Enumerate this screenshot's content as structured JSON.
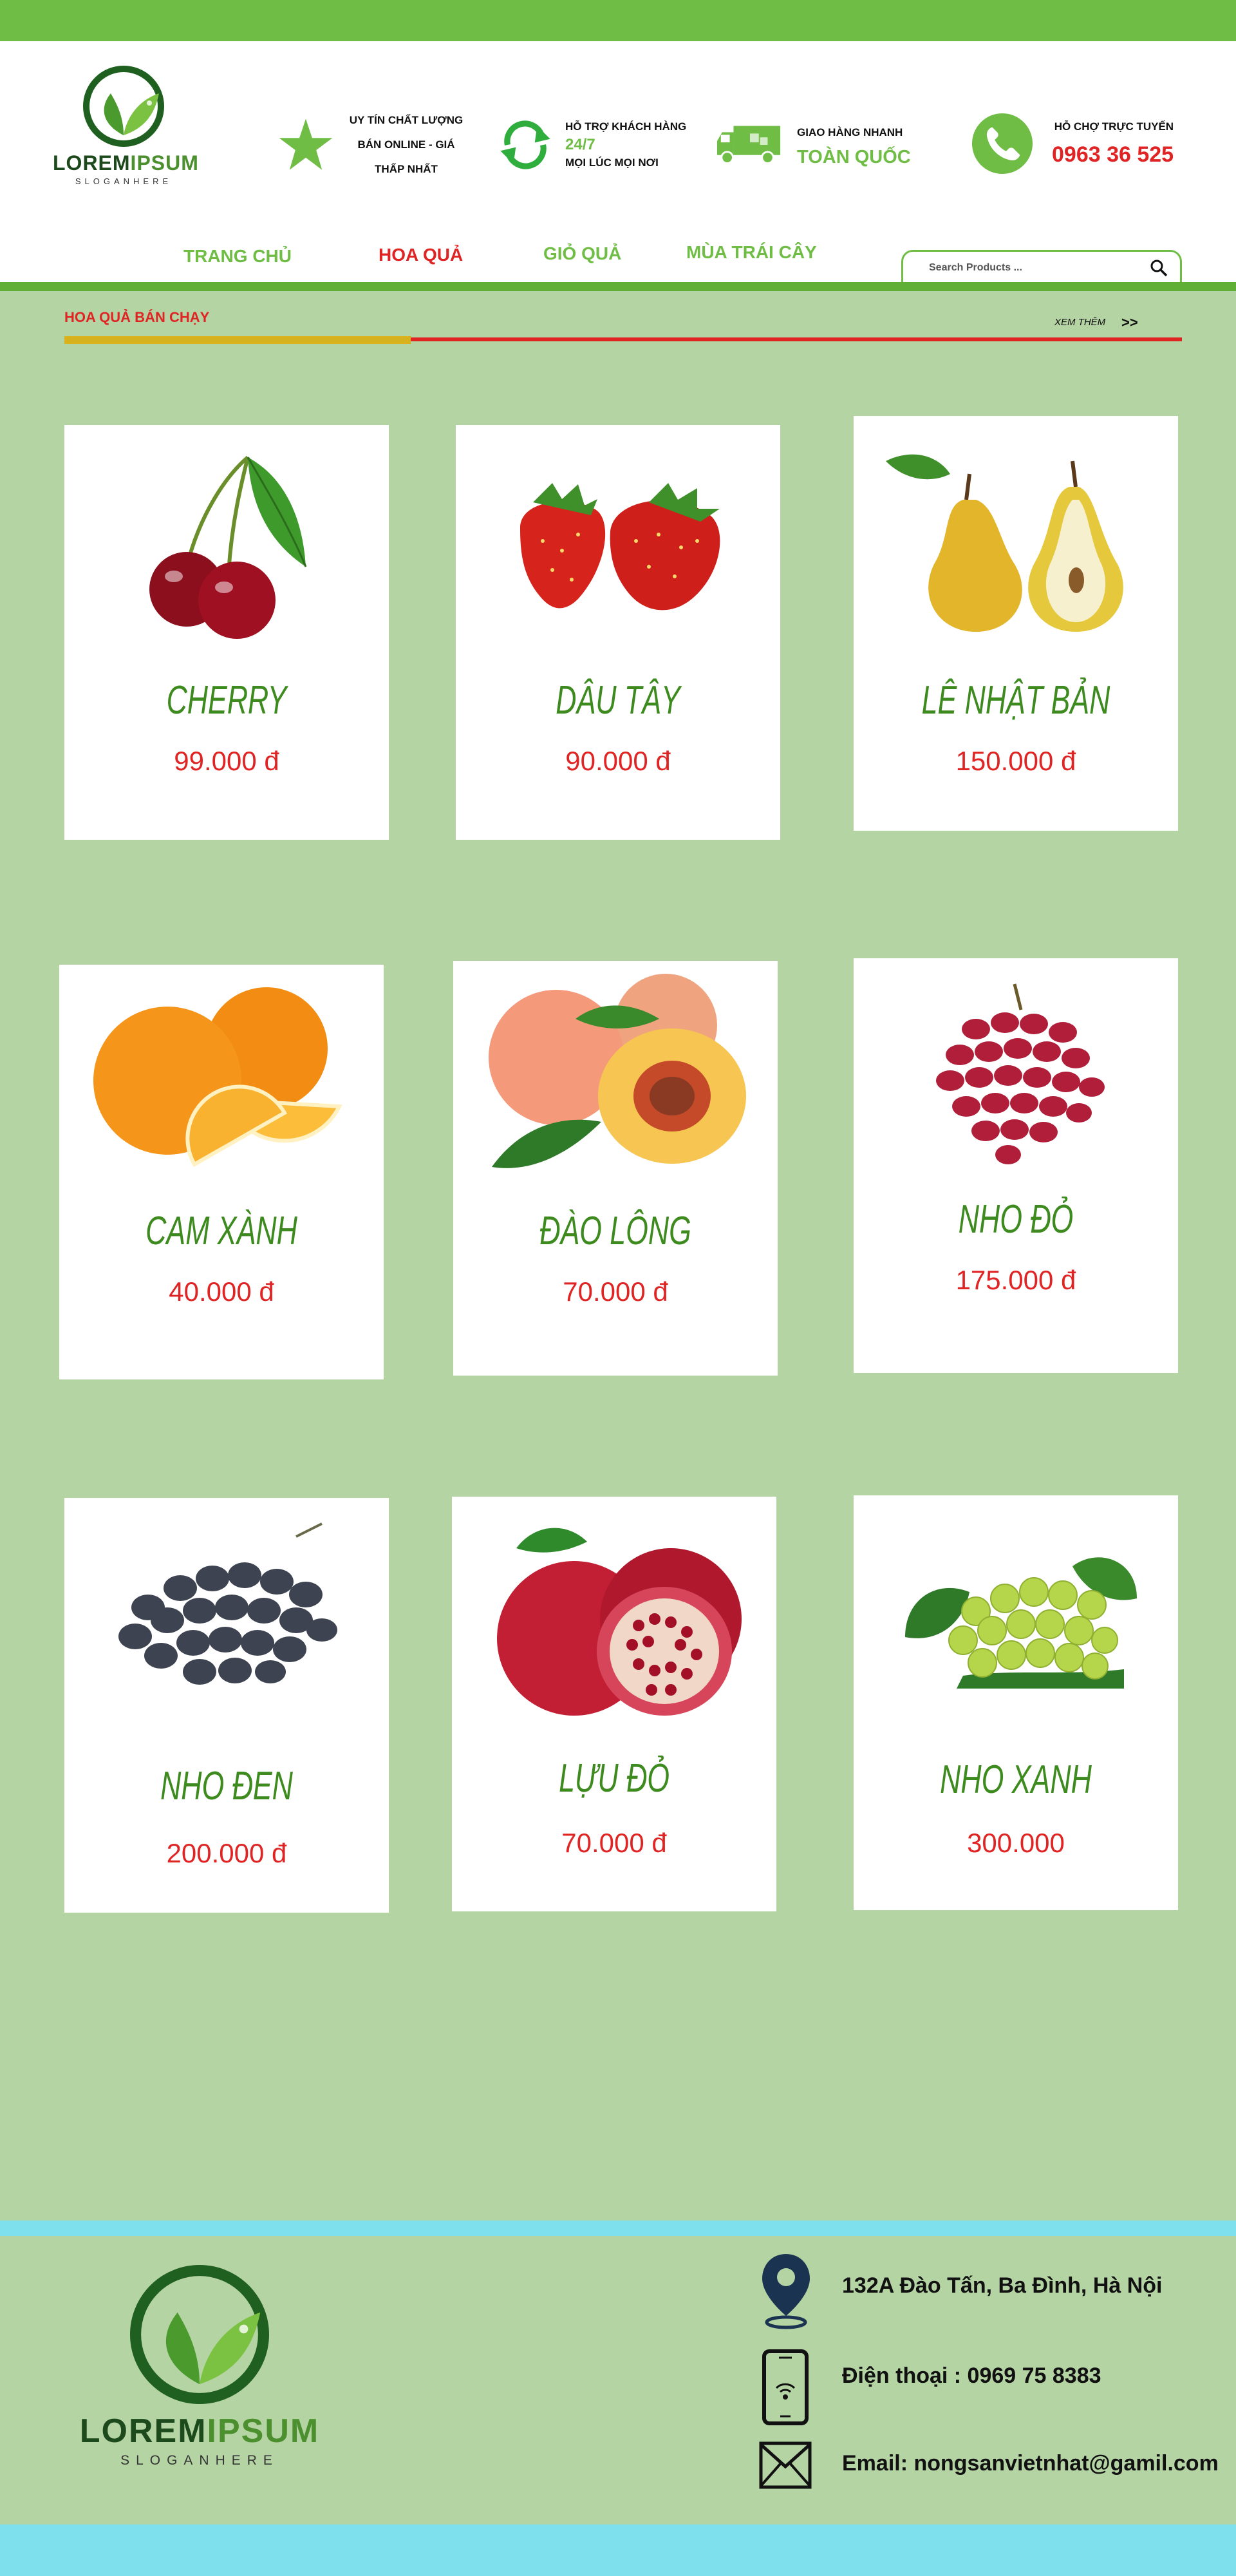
{
  "header": {
    "logo": {
      "brand_part1": "LOREM",
      "brand_part2": "IPSUM",
      "slogan": "SLOGANHERE"
    },
    "features": [
      {
        "icon": "star-icon",
        "lines": [
          "UY TÍN CHẤT LƯỢNG",
          "BÁN ONLINE - GIÁ",
          "THẤP NHẤT"
        ]
      },
      {
        "icon": "refresh-icon",
        "line1": "HỖ TRỢ KHÁCH HÀNG",
        "highlight": "24/7",
        "line2": "MỌI LÚC MỌI NƠI"
      },
      {
        "icon": "truck-icon",
        "line1": "GIAO HÀNG NHANH",
        "highlight": "TOÀN QUỐC"
      },
      {
        "icon": "phone-icon",
        "line1": "HỖ CHỢ TRỰC TUYẾN",
        "phone": "0963 36 525"
      }
    ]
  },
  "nav": {
    "items": [
      {
        "label": "TRANG CHỦ",
        "active": false
      },
      {
        "label": "HOA QUẢ",
        "active": true
      },
      {
        "label": "GIỎ QUẢ",
        "active": false
      },
      {
        "label": "MÙA TRÁI CÂY",
        "active": false
      }
    ],
    "search_placeholder": "Search Products ..."
  },
  "section": {
    "title": "HOA QUẢ BÁN CHẠY",
    "more_label": "XEM THÊM",
    "more_arrow": ">>"
  },
  "products": [
    {
      "name": "CHERRY",
      "price": "99.000 đ",
      "image": "cherry"
    },
    {
      "name": "DÂU TÂY",
      "price": "90.000 đ",
      "image": "strawberry"
    },
    {
      "name": "LÊ NHẬT BẢN",
      "price": "150.000 đ",
      "image": "pear"
    },
    {
      "name": "CAM XÀNH",
      "price": "40.000 đ",
      "image": "orange"
    },
    {
      "name": "ĐÀO LÔNG",
      "price": "70.000 đ",
      "image": "peach"
    },
    {
      "name": "NHO ĐỎ",
      "price": "175.000 đ",
      "image": "red-grapes"
    },
    {
      "name": "NHO ĐEN",
      "price": "200.000 đ",
      "image": "black-grapes"
    },
    {
      "name": "LỰU ĐỎ",
      "price": "70.000 đ",
      "image": "pomegranate"
    },
    {
      "name": "NHO XANH",
      "price": "300.000",
      "image": "green-grapes"
    }
  ],
  "footer": {
    "logo": {
      "brand_part1": "LOREM",
      "brand_part2": "IPSUM",
      "slogan": "SLOGANHERE"
    },
    "address": "132A Đào Tấn, Ba Đình, Hà Nội",
    "phone": "Điện thoại : 0969 75 8383",
    "email": "Email: nongsanvietnhat@gamil.com"
  },
  "colors": {
    "green": "#6fbd45",
    "red": "#e02424",
    "page_bg": "#b5d4a4",
    "product_name": "#3d8a1f",
    "footer_strip": "#7ee0ec"
  }
}
